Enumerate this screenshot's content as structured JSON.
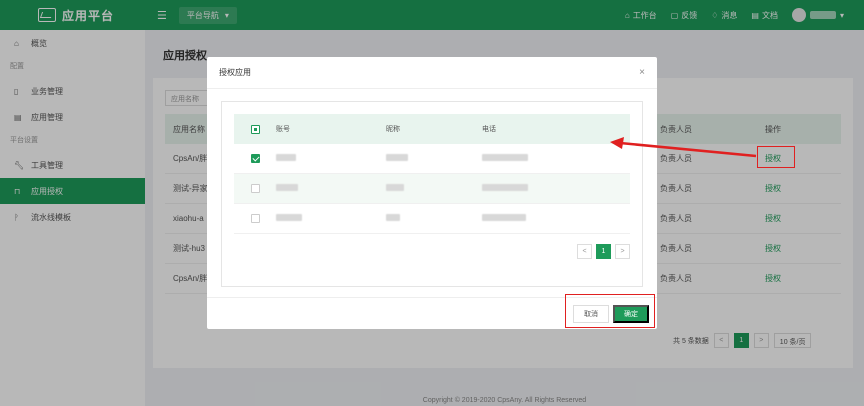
{
  "topbar": {
    "app_title": "应用平台",
    "nav_select": "平台导航",
    "links": [
      "工作台",
      "反馈",
      "消息",
      "文档"
    ]
  },
  "sidebar": {
    "overview": "概览",
    "group_config": "配置",
    "items_config": [
      "业务管理",
      "应用管理"
    ],
    "group_platform": "平台设置",
    "items_platform": [
      "工具管理",
      "应用授权",
      "流水线模板"
    ]
  },
  "page": {
    "title": "应用授权",
    "filter_placeholder": "应用名称",
    "table": {
      "headers": [
        "应用名称",
        "负责人员",
        "操作"
      ],
      "rows": [
        {
          "name": "CpsAn/胖",
          "owner": "负责人员",
          "op": "授权"
        },
        {
          "name": "测试-异家",
          "owner": "负责人员",
          "op": "授权"
        },
        {
          "name": "xiaohu-a",
          "owner": "负责人员",
          "op": "授权"
        },
        {
          "name": "测试-hu3",
          "owner": "负责人员",
          "op": "授权"
        },
        {
          "name": "CpsAn/胖",
          "owner": "负责人员",
          "op": "授权"
        }
      ]
    },
    "pager": {
      "total": "共 5 条数据",
      "current": "1",
      "page_size": "10 条/页"
    },
    "footer": "Copyright © 2019-2020 CpsAny. All Rights Reserved"
  },
  "modal": {
    "title": "授权应用",
    "close": "×",
    "headers": [
      "账号",
      "昵称",
      "电话"
    ],
    "rows": [
      {
        "checked": true
      },
      {
        "checked": false
      },
      {
        "checked": false
      }
    ],
    "pager": {
      "prev": "<",
      "current": "1",
      "next": ">"
    },
    "cancel": "取消",
    "ok": "确定"
  },
  "colors": {
    "brand": "#1e9b5a",
    "annotation": "#e02020"
  }
}
